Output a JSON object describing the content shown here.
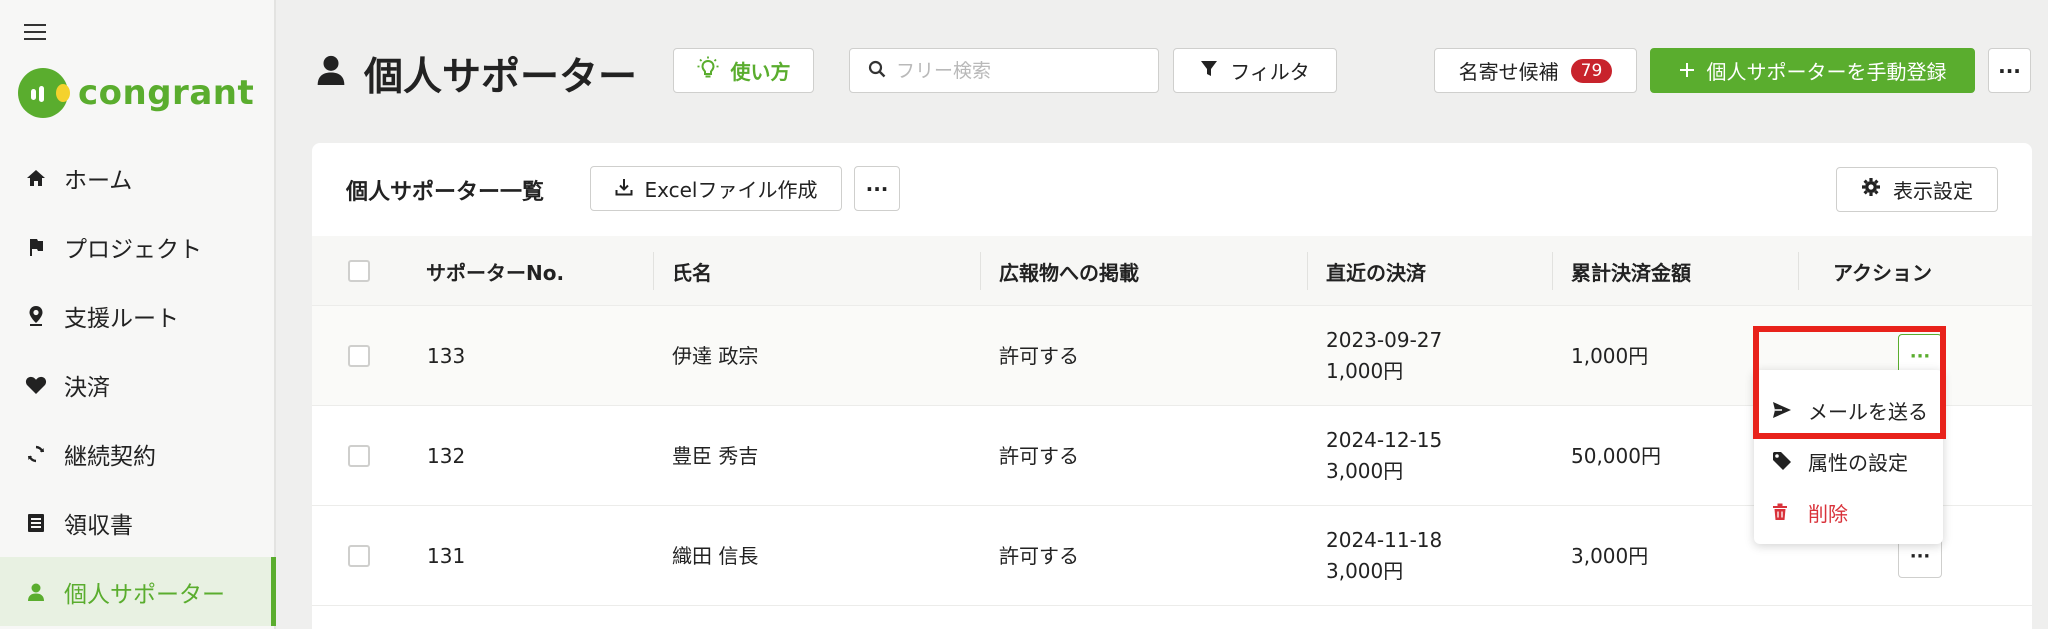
{
  "sidebar": {
    "logo_text": "congrant",
    "items": [
      {
        "label": "ホーム",
        "icon": "home-icon"
      },
      {
        "label": "プロジェクト",
        "icon": "flag-icon"
      },
      {
        "label": "支援ルート",
        "icon": "location-pin-icon"
      },
      {
        "label": "決済",
        "icon": "heart-icon"
      },
      {
        "label": "継続契約",
        "icon": "refresh-icon"
      },
      {
        "label": "領収書",
        "icon": "receipt-icon"
      },
      {
        "label": "個人サポーター",
        "icon": "person-icon",
        "active": true
      }
    ]
  },
  "header": {
    "title": "個人サポーター",
    "howto_label": "使い方",
    "search_placeholder": "フリー検索",
    "filter_label": "フィルタ",
    "merge_label": "名寄せ候補",
    "merge_count": "79",
    "register_label": "個人サポーターを手動登録",
    "more_label": "···"
  },
  "card": {
    "title": "個人サポーター一覧",
    "excel_label": "Excelファイル作成",
    "more_label": "···",
    "display_label": "表示設定"
  },
  "table": {
    "headers": [
      "サポーターNo.",
      "氏名",
      "広報物への掲載",
      "直近の決済",
      "累計決済金額",
      "アクション"
    ],
    "rows": [
      {
        "no": "133",
        "name": "伊達 政宗",
        "publicity": "許可する",
        "date": "2023-09-27",
        "amount": "1,000円",
        "total": "1,000円"
      },
      {
        "no": "132",
        "name": "豊臣 秀吉",
        "publicity": "許可する",
        "date": "2024-12-15",
        "amount": "3,000円",
        "total": "50,000円"
      },
      {
        "no": "131",
        "name": "織田 信長",
        "publicity": "許可する",
        "date": "2024-11-18",
        "amount": "3,000円",
        "total": "3,000円"
      }
    ],
    "row_more_label": "···"
  },
  "dropdown": {
    "items": [
      {
        "label": "メールを送る",
        "icon": "send-icon"
      },
      {
        "label": "属性の設定",
        "icon": "tag-icon"
      },
      {
        "label": "削除",
        "icon": "trash-icon",
        "danger": true
      }
    ]
  },
  "colors": {
    "brand_green": "#5aad2e",
    "badge_red": "#c8232c",
    "highlight_red": "#e8221b",
    "danger_red": "#d9323a"
  }
}
